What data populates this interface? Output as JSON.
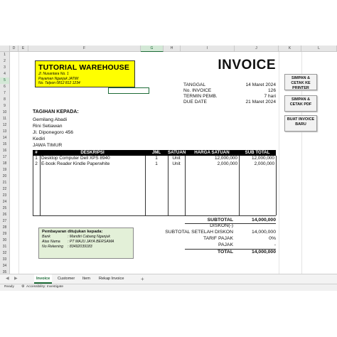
{
  "sheet": {
    "columns": [
      "D",
      "E",
      "F",
      "G",
      "H",
      "I",
      "J",
      "K",
      "L"
    ],
    "selected_column": "G",
    "rows": [
      "1",
      "2",
      "3",
      "4",
      "5",
      "6",
      "7",
      "8",
      "9",
      "10",
      "11",
      "12",
      "13",
      "14",
      "15",
      "16",
      "17",
      "18",
      "19",
      "20",
      "21",
      "22",
      "23",
      "24",
      "25",
      "26",
      "27",
      "28",
      "29",
      "30",
      "31",
      "32",
      "33",
      "34",
      "35"
    ],
    "selected_row": "5"
  },
  "company": {
    "name": "TUTORIAL WAREHOUSE",
    "address": "Jl. Nusantara No. 1",
    "city": "Payaman Nganjuk JATIM",
    "phone": "No. Telpon 0812 812 1234"
  },
  "invoice": {
    "title": "INVOICE",
    "fields": [
      {
        "label": "TANGGAL",
        "value": "14 Maret 2024"
      },
      {
        "label": "No. INVOICE",
        "value": "126"
      },
      {
        "label": "TERMIN PEMB.",
        "value": "7 hari"
      },
      {
        "label": "DUE DATE",
        "value": "21 Maret 2024"
      }
    ]
  },
  "bill_to": {
    "label": "TAGIHAN KEPADA:",
    "lines": [
      "Gemilang Abadi",
      "Rini Setiawan",
      "Jl. Diponegoro 456",
      "Kediri",
      "JAWA TIMUR"
    ]
  },
  "table": {
    "headers": [
      "#",
      "DESKRIPSI",
      "JML",
      "SATUAN",
      "HARGA SATUAN",
      "SUB TOTAL"
    ],
    "rows": [
      [
        "1",
        "Desktop Computer Dell XPS 8940",
        "1",
        "Unit",
        "12,000,000",
        "12,000,000"
      ],
      [
        "2",
        "E-book Reader Kindle Paperwhite",
        "1",
        "Unit",
        "2,000,000",
        "2,000,000"
      ]
    ]
  },
  "payment": {
    "title": "Pembayaran ditujukan kepada:",
    "lines": [
      {
        "label": "Bank",
        "value": ": Mandiri Cabang Nganjuk"
      },
      {
        "label": "Atas Nama",
        "value": ": PT MAJU JAYA BERSAMA"
      },
      {
        "label": "No Rekening",
        "value": ": 83492039183"
      }
    ]
  },
  "summary": {
    "subtotal_label": "SUBTOTAL",
    "subtotal_value": "14,000,000",
    "diskon_label": "DISKON(-)",
    "diskon_value": "",
    "after_diskon_label": "SUBTOTAL SETELAH DISKON",
    "after_diskon_value": "14,000,000",
    "tarif_label": "TARIF PAJAK",
    "tarif_value": "0%",
    "pajak_label": "PAJAK",
    "pajak_value": "-",
    "total_label": "TOTAL",
    "total_value": "14,000,000"
  },
  "buttons": {
    "save_print": "SIMPAN & CETAK KE PRINTER",
    "save_pdf": "SIMPAN & CETAK PDF",
    "new_invoice": "BUAT INVOICE BARU"
  },
  "tabs": [
    "Invoice",
    "Customer",
    "Item",
    "Rekap Invoice"
  ],
  "active_tab": "Invoice",
  "status": {
    "ready": "Ready",
    "accessibility": "Accessibility: Investigate"
  },
  "colors": {
    "excel_green": "#1d6b37",
    "company_yellow": "#ffff00",
    "payment_green": "#e3f0d8",
    "header_black": "#000000"
  }
}
